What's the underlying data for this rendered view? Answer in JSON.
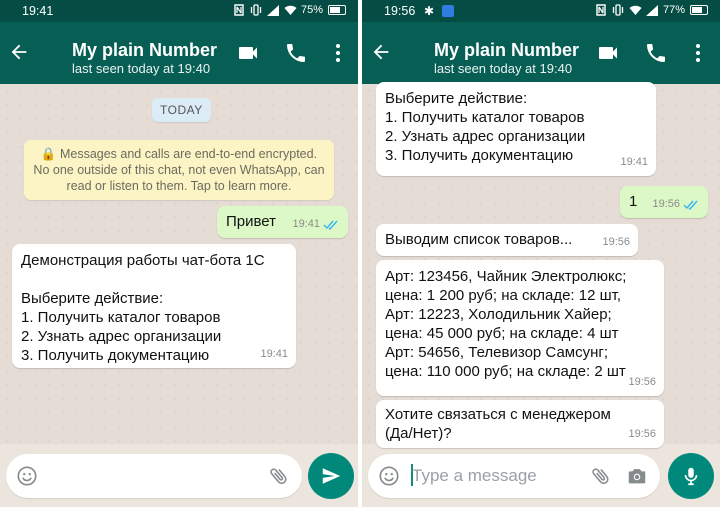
{
  "left": {
    "status": {
      "time": "19:41",
      "battery": "75%"
    },
    "header": {
      "contact_name": "My plain Number",
      "last_seen": "last seen today at 19:40"
    },
    "date_chip": "TODAY",
    "encryption_notice": "🔒 Messages and calls are end-to-end encrypted. No one outside of this chat, not even WhatsApp, can read or listen to them. Tap to learn more.",
    "messages": [
      {
        "direction": "out",
        "text": "Привет",
        "time": "19:41",
        "read": true
      },
      {
        "direction": "in",
        "text": "Демонстрация работы чат-бота 1С\n\nВыберите действие:\n1. Получить каталог товаров\n2. Узнать адрес организации\n3. Получить документацию",
        "time": "19:41"
      }
    ],
    "input": {
      "placeholder": ""
    }
  },
  "right": {
    "status": {
      "time": "19:56",
      "battery": "77%"
    },
    "header": {
      "contact_name": "My plain Number",
      "last_seen": "last seen today at 19:40"
    },
    "messages": [
      {
        "direction": "in",
        "text": "Выберите действие:\n1. Получить каталог товаров\n2. Узнать адрес организации\n3. Получить документацию",
        "time": "19:41"
      },
      {
        "direction": "out",
        "text": "1",
        "time": "19:56",
        "read": true
      },
      {
        "direction": "in",
        "text": "Выводим список товаров...",
        "time": "19:56"
      },
      {
        "direction": "in",
        "text": "Арт: 123456, Чайник Электролюкс;\nцена: 1 200 руб; на складе: 12 шт,\nАрт: 12223, Холодильник Хайер;\nцена: 45 000 руб; на складе: 4 шт\nАрт: 54656, Телевизор Самсунг;\nцена: 110 000 руб; на складе: 2 шт",
        "time": "19:56"
      },
      {
        "direction": "in",
        "text": "Хотите связаться с менеджером\n(Да/Нет)?",
        "time": "19:56"
      }
    ],
    "input": {
      "placeholder": "Type a message"
    }
  },
  "colors": {
    "status_bar": "#054d44",
    "app_bar": "#075e54",
    "outgoing_bubble": "#dcf8c6",
    "incoming_bubble": "#ffffff",
    "send_button": "#00897b",
    "read_ticks": "#34b7f1"
  },
  "icons": {
    "back": "arrow-left-icon",
    "video_call": "video-camera-icon",
    "voice_call": "phone-icon",
    "menu": "more-vert-icon",
    "emoji": "smiley-icon",
    "attach": "paperclip-icon",
    "camera": "camera-icon",
    "send": "send-icon",
    "mic": "microphone-icon"
  }
}
